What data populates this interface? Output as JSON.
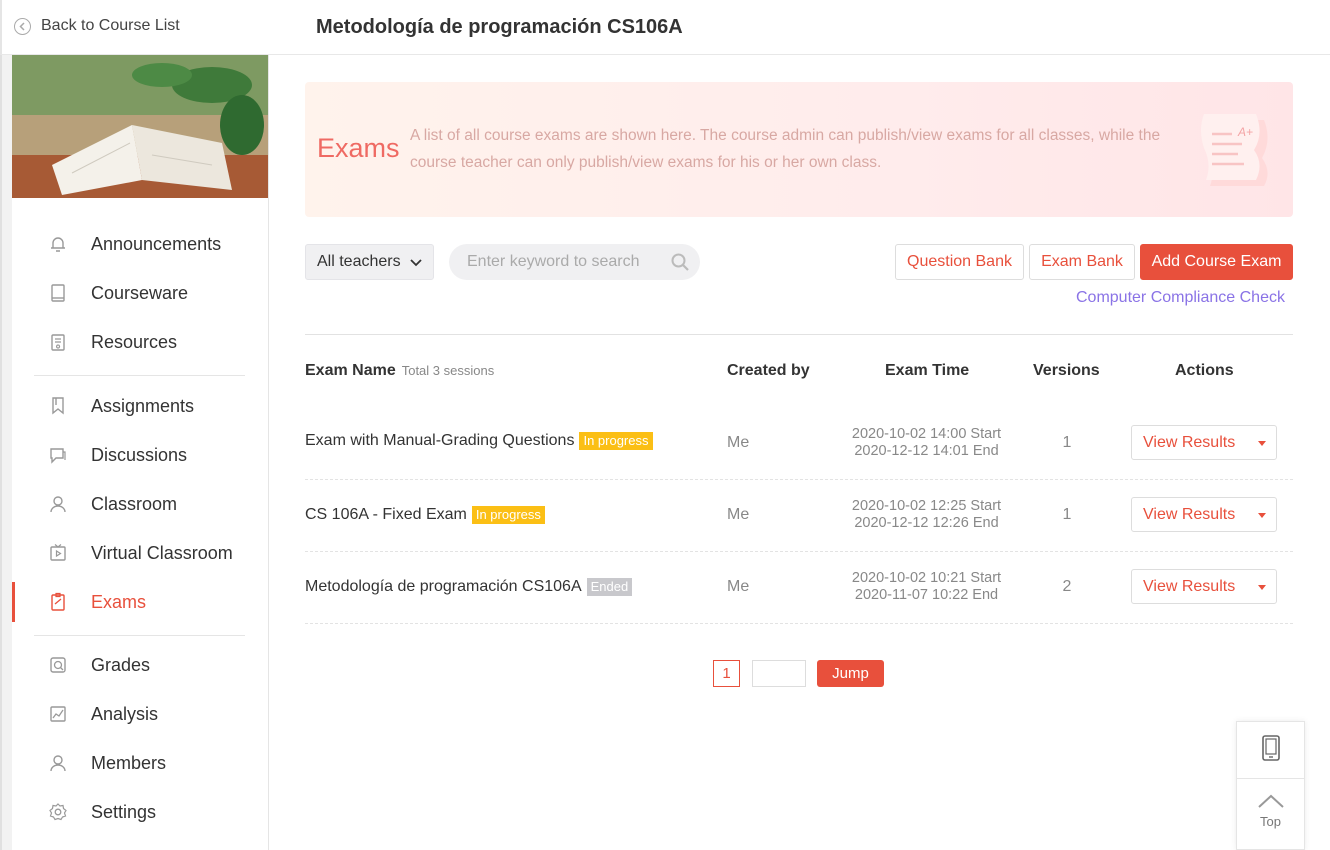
{
  "header": {
    "back_label": "Back to Course List",
    "course_title": "Metodología de programación CS106A"
  },
  "sidebar": {
    "items": [
      {
        "label": "Announcements",
        "icon": "bell-icon"
      },
      {
        "label": "Courseware",
        "icon": "book-icon"
      },
      {
        "label": "Resources",
        "icon": "folder-icon"
      },
      {
        "label": "Assignments",
        "icon": "bookmark-icon"
      },
      {
        "label": "Discussions",
        "icon": "chat-icon"
      },
      {
        "label": "Classroom",
        "icon": "person-icon"
      },
      {
        "label": "Virtual Classroom",
        "icon": "video-icon"
      },
      {
        "label": "Exams",
        "icon": "exam-icon",
        "active": true
      },
      {
        "label": "Grades",
        "icon": "grades-icon"
      },
      {
        "label": "Analysis",
        "icon": "chart-icon"
      },
      {
        "label": "Members",
        "icon": "members-icon"
      },
      {
        "label": "Settings",
        "icon": "gear-icon"
      }
    ]
  },
  "hero": {
    "title": "Exams",
    "description": "A list of all course exams are shown here. The course admin can publish/view exams for all classes, while the course teacher can only publish/view exams for his or her own class."
  },
  "toolbar": {
    "teacher_filter": "All teachers",
    "search_placeholder": "Enter keyword to search",
    "question_bank": "Question Bank",
    "exam_bank": "Exam Bank",
    "add_exam": "Add Course Exam",
    "compliance_check": "Computer Compliance Check"
  },
  "table": {
    "headers": {
      "name": "Exam Name",
      "total": "Total 3 sessions",
      "created_by": "Created by",
      "time": "Exam Time",
      "versions": "Versions",
      "actions": "Actions"
    },
    "rows": [
      {
        "name": "Exam with Manual-Grading Questions",
        "status": "In progress",
        "creator": "Me",
        "start": "2020-10-02 14:00 Start",
        "end": "2020-12-12 14:01 End",
        "versions": "1",
        "action": "View Results"
      },
      {
        "name": "CS 106A - Fixed Exam",
        "status": "In progress",
        "creator": "Me",
        "start": "2020-10-02 12:25 Start",
        "end": "2020-12-12 12:26 End",
        "versions": "1",
        "action": "View Results"
      },
      {
        "name": "Metodología de programación CS106A",
        "status": "Ended",
        "creator": "Me",
        "start": "2020-10-02 10:21 Start",
        "end": "2020-11-07 10:22 End",
        "versions": "2",
        "action": "View Results"
      }
    ]
  },
  "pagination": {
    "current_page": "1",
    "jump_label": "Jump"
  },
  "float_panel": {
    "top_label": "Top"
  },
  "colors": {
    "accent": "#e8503c",
    "progress_badge": "#fbbf15",
    "ended_badge": "#c8c8cc",
    "link_purple": "#8a73e6"
  }
}
